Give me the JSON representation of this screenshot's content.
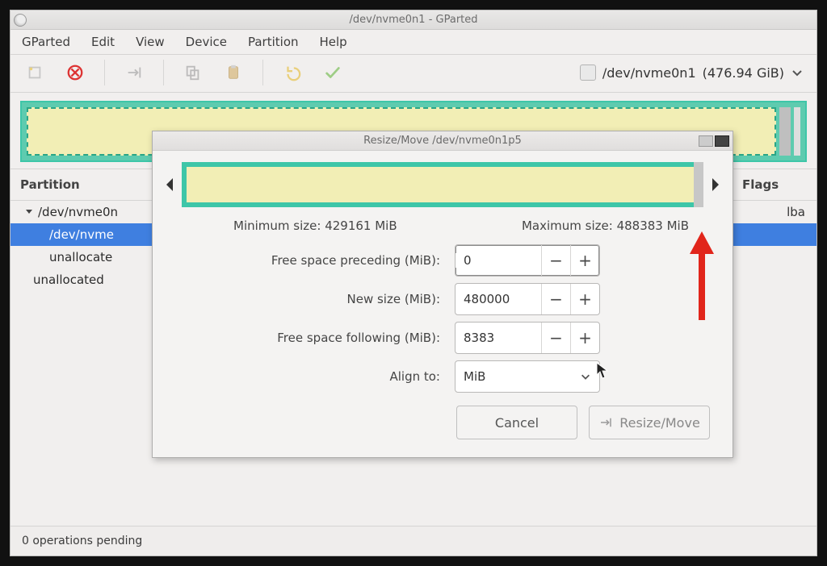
{
  "titlebar": {
    "text": "/dev/nvme0n1 - GParted"
  },
  "menu": {
    "gparted": "GParted",
    "edit": "Edit",
    "view": "View",
    "device": "Device",
    "partition": "Partition",
    "help": "Help"
  },
  "toolbar": {
    "device_label": "/dev/nvme0n1",
    "device_size": "(476.94 GiB)"
  },
  "columns": {
    "partition": "Partition",
    "flags": "Flags"
  },
  "rows": {
    "root": "/dev/nvme0n",
    "child": "/dev/nvme",
    "unalloc1": "unallocate",
    "unalloc2": "unallocated",
    "flag_lba": "lba"
  },
  "statusbar": {
    "text": "0 operations pending"
  },
  "dialog": {
    "title": "Resize/Move /dev/nvme0n1p5",
    "min_label": "Minimum size: 429161 MiB",
    "max_label": "Maximum size: 488383 MiB",
    "preceding_label": "Free space preceding (MiB):",
    "preceding_value": "0",
    "newsize_label": "New size (MiB):",
    "newsize_value": "480000",
    "following_label": "Free space following (MiB):",
    "following_value": "8383",
    "align_label": "Align to:",
    "align_value": "MiB",
    "cancel": "Cancel",
    "resize": "Resize/Move"
  },
  "icons": {
    "new": "new-icon",
    "delete": "delete-icon",
    "resize": "resize-icon",
    "copy": "copy-icon",
    "paste": "paste-icon",
    "undo": "undo-icon",
    "apply": "apply-icon",
    "chevron": "chevron-down-icon"
  }
}
